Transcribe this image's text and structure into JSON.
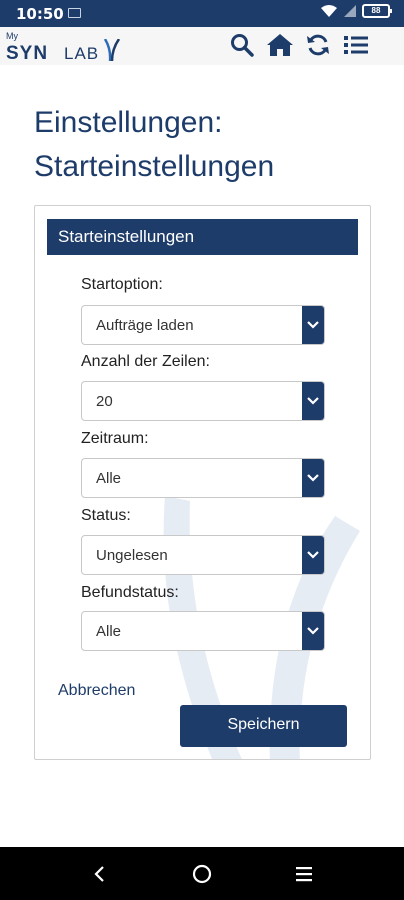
{
  "status_bar": {
    "time": "10:50",
    "battery": "88"
  },
  "app_bar": {
    "logo_my": "My",
    "logo_syn": "SYN",
    "logo_lab": "LAB",
    "icons": [
      "search-icon",
      "home-icon",
      "refresh-icon",
      "menu-list-icon"
    ]
  },
  "page": {
    "title_line1": "Einstellungen:",
    "title_line2": "Starteinstellungen"
  },
  "card": {
    "header": "Starteinstellungen",
    "fields": [
      {
        "label": "Startoption:",
        "value": "Aufträge laden"
      },
      {
        "label": "Anzahl der Zeilen:",
        "value": "20"
      },
      {
        "label": "Zeitraum:",
        "value": "Alle"
      },
      {
        "label": "Status:",
        "value": "Ungelesen"
      },
      {
        "label": "Befundstatus:",
        "value": "Alle"
      }
    ],
    "cancel_label": "Abbrechen",
    "save_label": "Speichern"
  },
  "nav_bar": {
    "buttons": [
      "back-icon",
      "home-circle-icon",
      "recents-icon"
    ]
  },
  "colors": {
    "brand": "#1e3c6a",
    "watermark": "#e6ecf4"
  }
}
